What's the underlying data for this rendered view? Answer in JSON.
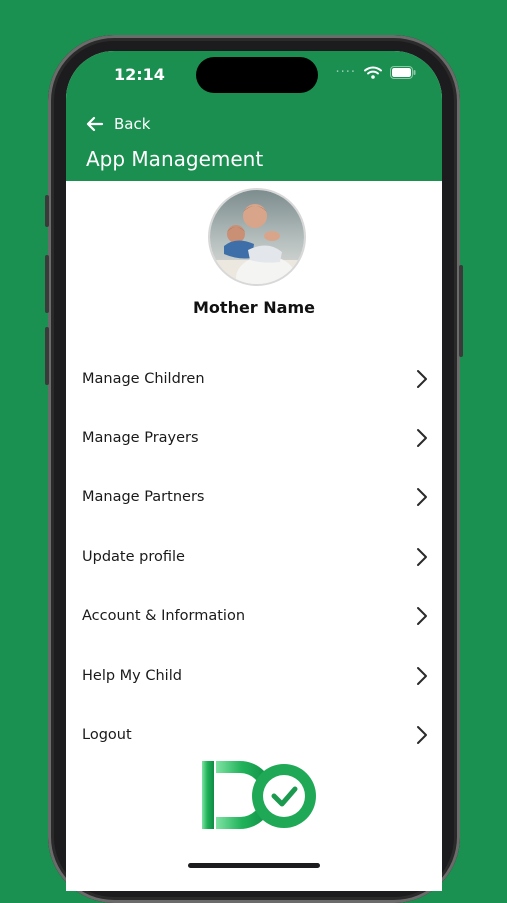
{
  "status_bar": {
    "time": "12:14"
  },
  "nav": {
    "back_label": "Back",
    "title": "App Management"
  },
  "profile": {
    "name": "Mother Name"
  },
  "menu": {
    "items": [
      {
        "label": "Manage Children"
      },
      {
        "label": "Manage Prayers"
      },
      {
        "label": "Manage Partners"
      },
      {
        "label": "Update profile"
      },
      {
        "label": "Account & Information"
      },
      {
        "label": "Help My Child"
      },
      {
        "label": "Logout"
      }
    ]
  },
  "colors": {
    "background": "#1a9150",
    "header": "#1b8f50",
    "accent": "#1f9a54"
  },
  "icons": [
    "back-arrow-icon",
    "wifi-icon",
    "battery-icon",
    "signal-dots-icon",
    "chevron-right-icon",
    "app-logo"
  ]
}
